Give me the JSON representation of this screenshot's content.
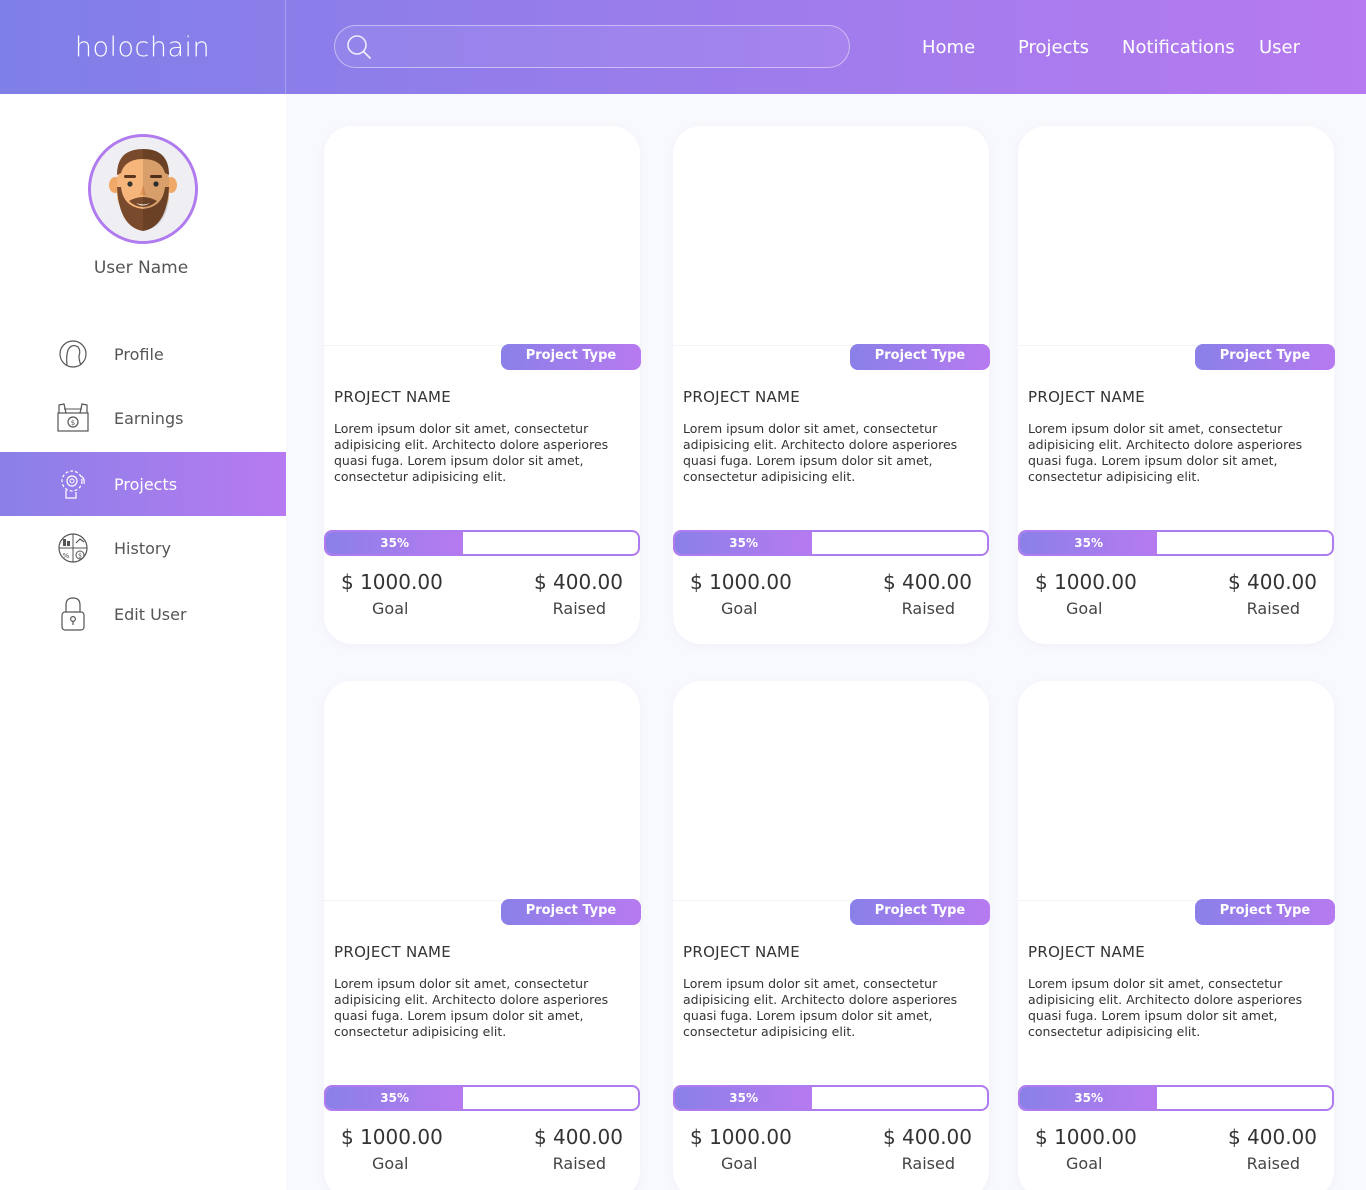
{
  "header": {
    "logo": "holochain",
    "search": {
      "value": "",
      "placeholder": ""
    },
    "nav": [
      "Home",
      "Projects",
      "Notifications",
      "User"
    ]
  },
  "sidebar": {
    "user_name": "User Name",
    "menu": [
      {
        "label": "Profile",
        "icon": "user-head-icon",
        "active": false
      },
      {
        "label": "Earnings",
        "icon": "money-hands-icon",
        "active": false
      },
      {
        "label": "Projects",
        "icon": "gear-brain-icon",
        "active": true
      },
      {
        "label": "History",
        "icon": "finance-chart-icon",
        "active": false
      },
      {
        "label": "Edit User",
        "icon": "padlock-icon",
        "active": false
      }
    ]
  },
  "colors": {
    "accent_start": "#7f7fe8",
    "accent_end": "#b77af0",
    "background": "#f8f9fd"
  },
  "cards": [
    {
      "type": "Project Type",
      "name": "PROJECT NAME",
      "description": "Lorem ipsum dolor sit amet, consectetur adipisicing elit. Architecto dolore asperiores quasi fuga. Lorem ipsum dolor sit amet, consectetur adipisicing elit.",
      "progress_label": "35%",
      "progress": 0.44,
      "goal": "$ 1000.00",
      "goal_label": "Goal",
      "raised": "$ 400.00",
      "raised_label": "Raised"
    },
    {
      "type": "Project Type",
      "name": "PROJECT NAME",
      "description": "Lorem ipsum dolor sit amet, consectetur adipisicing elit. Architecto dolore asperiores quasi fuga. Lorem ipsum dolor sit amet, consectetur adipisicing elit.",
      "progress_label": "35%",
      "progress": 0.44,
      "goal": "$ 1000.00",
      "goal_label": "Goal",
      "raised": "$ 400.00",
      "raised_label": "Raised"
    },
    {
      "type": "Project Type",
      "name": "PROJECT NAME",
      "description": "Lorem ipsum dolor sit amet, consectetur adipisicing elit. Architecto dolore asperiores quasi fuga. Lorem ipsum dolor sit amet, consectetur adipisicing elit.",
      "progress_label": "35%",
      "progress": 0.44,
      "goal": "$ 1000.00",
      "goal_label": "Goal",
      "raised": "$ 400.00",
      "raised_label": "Raised"
    },
    {
      "type": "Project Type",
      "name": "PROJECT NAME",
      "description": "Lorem ipsum dolor sit amet, consectetur adipisicing elit. Architecto dolore asperiores quasi fuga. Lorem ipsum dolor sit amet, consectetur adipisicing elit.",
      "progress_label": "35%",
      "progress": 0.44,
      "goal": "$ 1000.00",
      "goal_label": "Goal",
      "raised": "$ 400.00",
      "raised_label": "Raised"
    },
    {
      "type": "Project Type",
      "name": "PROJECT NAME",
      "description": "Lorem ipsum dolor sit amet, consectetur adipisicing elit. Architecto dolore asperiores quasi fuga. Lorem ipsum dolor sit amet, consectetur adipisicing elit.",
      "progress_label": "35%",
      "progress": 0.44,
      "goal": "$ 1000.00",
      "goal_label": "Goal",
      "raised": "$ 400.00",
      "raised_label": "Raised"
    },
    {
      "type": "Project Type",
      "name": "PROJECT NAME",
      "description": "Lorem ipsum dolor sit amet, consectetur adipisicing elit. Architecto dolore asperiores quasi fuga. Lorem ipsum dolor sit amet, consectetur adipisicing elit.",
      "progress_label": "35%",
      "progress": 0.44,
      "goal": "$ 1000.00",
      "goal_label": "Goal",
      "raised": "$ 400.00",
      "raised_label": "Raised"
    }
  ]
}
